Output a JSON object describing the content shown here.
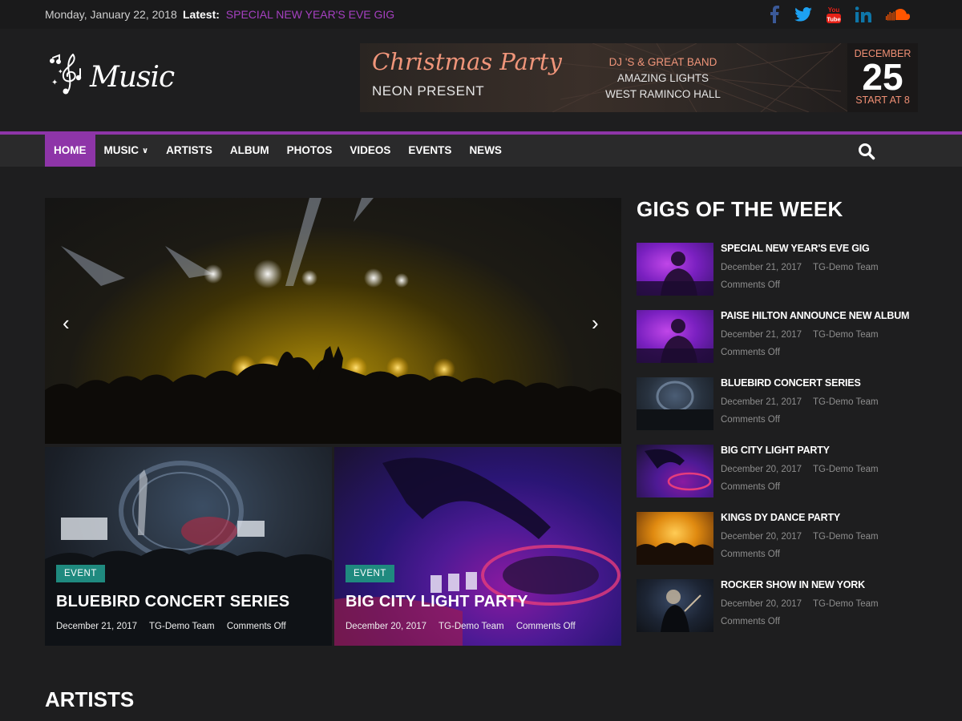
{
  "topbar": {
    "date": "Monday, January 22, 2018",
    "latest_label": "Latest:",
    "latest_link": "SPECIAL NEW YEAR'S EVE GIG"
  },
  "social": [
    {
      "icon": "facebook-icon",
      "color": "#3b5998"
    },
    {
      "icon": "twitter-icon",
      "color": "#1da1f2"
    },
    {
      "icon": "youtube-icon",
      "color": "#e62117"
    },
    {
      "icon": "linkedin-icon",
      "color": "#0e76a8"
    },
    {
      "icon": "soundcloud-icon",
      "color": "#ff5500"
    }
  ],
  "header": {
    "logo_text": "Music"
  },
  "banner": {
    "title": "Christmas Party",
    "subtitle": "NEON PRESENT",
    "line1": "DJ 'S & GREAT BAND",
    "line2": "AMAZING LIGHTS",
    "line3": "WEST RAMINCO HALL",
    "month": "DECEMBER",
    "day": "25",
    "start": "START AT 8"
  },
  "nav": {
    "items": [
      {
        "label": "HOME",
        "active": true
      },
      {
        "label": "MUSIC",
        "has_dropdown": true
      },
      {
        "label": "ARTISTS"
      },
      {
        "label": "ALBUM"
      },
      {
        "label": "PHOTOS"
      },
      {
        "label": "VIDEOS"
      },
      {
        "label": "EVENTS"
      },
      {
        "label": "NEWS"
      }
    ],
    "accent": "#8e35a8"
  },
  "featured": [
    {
      "tag": "EVENT",
      "title": "BLUEBIRD CONCERT SERIES",
      "date": "December 21, 2017",
      "author": "TG-Demo Team",
      "comments": "Comments Off"
    },
    {
      "tag": "EVENT",
      "title": "BIG CITY LIGHT PARTY",
      "date": "December 20, 2017",
      "author": "TG-Demo Team",
      "comments": "Comments Off"
    }
  ],
  "sidebar": {
    "heading": "GIGS OF THE WEEK",
    "gigs": [
      {
        "title": "SPECIAL NEW YEAR'S EVE GIG",
        "date": "December 21, 2017",
        "author": "TG-Demo Team",
        "comments": "Comments Off"
      },
      {
        "title": "PAISE HILTON ANNOUNCE NEW ALBUM",
        "date": "December 21, 2017",
        "author": "TG-Demo Team",
        "comments": "Comments Off"
      },
      {
        "title": "BLUEBIRD CONCERT SERIES",
        "date": "December 21, 2017",
        "author": "TG-Demo Team",
        "comments": "Comments Off"
      },
      {
        "title": "BIG CITY LIGHT PARTY",
        "date": "December 20, 2017",
        "author": "TG-Demo Team",
        "comments": "Comments Off"
      },
      {
        "title": "KINGS DY DANCE PARTY",
        "date": "December 20, 2017",
        "author": "TG-Demo Team",
        "comments": "Comments Off"
      },
      {
        "title": "ROCKER SHOW IN NEW YORK",
        "date": "December 20, 2017",
        "author": "TG-Demo Team",
        "comments": "Comments Off"
      }
    ]
  },
  "sections": {
    "artists_heading": "ARTISTS"
  }
}
